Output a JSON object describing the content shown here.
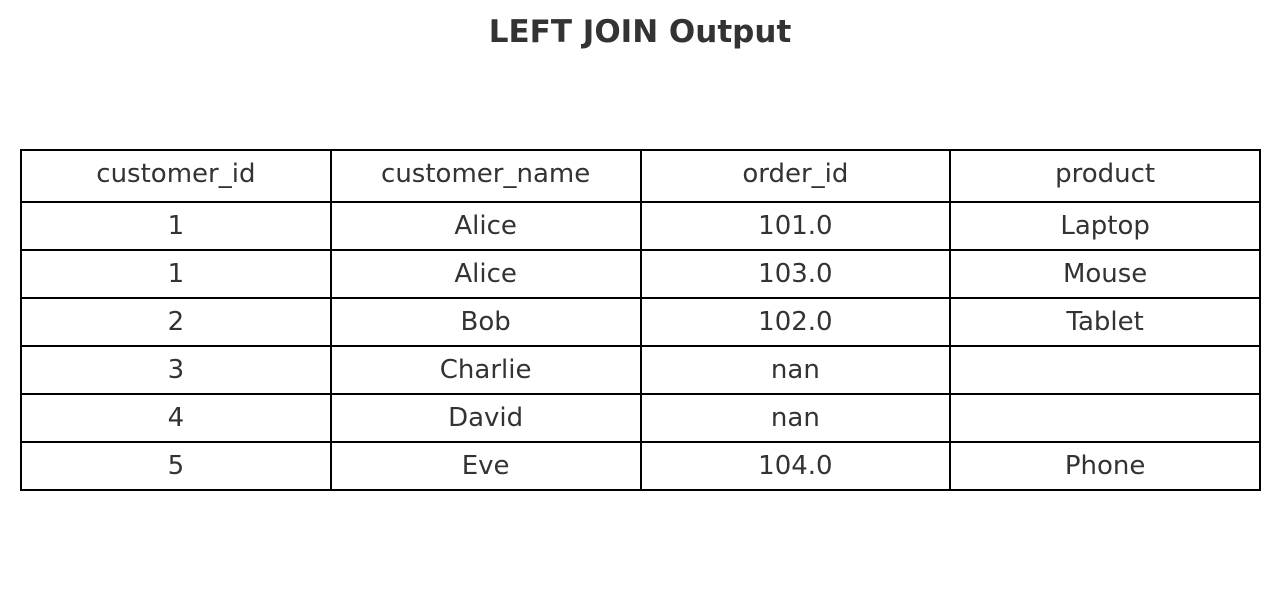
{
  "chart_data": {
    "type": "table",
    "title": "LEFT JOIN Output",
    "columns": [
      "customer_id",
      "customer_name",
      "order_id",
      "product"
    ],
    "rows": [
      [
        "1",
        "Alice",
        "101.0",
        "Laptop"
      ],
      [
        "1",
        "Alice",
        "103.0",
        "Mouse"
      ],
      [
        "2",
        "Bob",
        "102.0",
        "Tablet"
      ],
      [
        "3",
        "Charlie",
        "nan",
        ""
      ],
      [
        "4",
        "David",
        "nan",
        ""
      ],
      [
        "5",
        "Eve",
        "104.0",
        "Phone"
      ]
    ]
  }
}
